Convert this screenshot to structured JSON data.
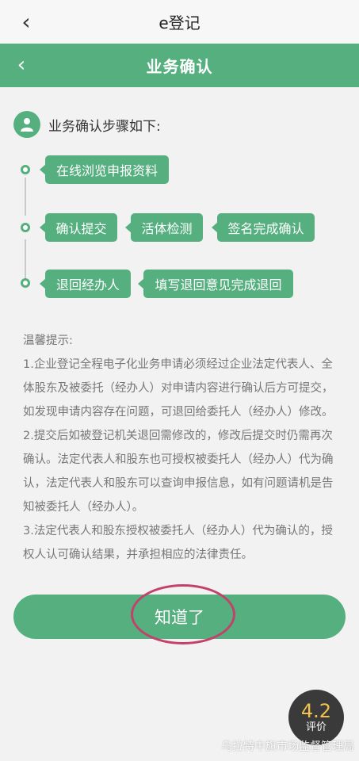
{
  "app": {
    "title": "e登记"
  },
  "header": {
    "title": "业务确认"
  },
  "steps": {
    "heading": "业务确认步骤如下:",
    "row1": [
      "在线浏览申报资料"
    ],
    "row2": [
      "确认提交",
      "活体检测",
      "签名完成确认"
    ],
    "row3": [
      "退回经办人",
      "填写退回意见完成退回"
    ]
  },
  "tips": {
    "title": "温馨提示:",
    "lines": [
      "1.企业登记全程电子化业务申请必须经过企业法定代表人、全体股东及被委托（经办人）对申请内容进行确认后方可提交，如发现申请内容存在问题，可退回给委托人（经办人）修改。",
      "2.提交后如被登记机关退回需修改的，修改后提交时仍需再次确认。法定代表人和股东也可授权被委托人（经办人）代为确认，法定代表人和股东可以查询申报信息，如有问题请机是告知被委托人（经办人）。",
      "3.法定代表人和股东授权被委托人（经办人）代为确认的，授权人认可确认结果，并承担相应的法律责任。"
    ]
  },
  "button": {
    "label": "知道了"
  },
  "rating": {
    "score": "4.2",
    "label": "评价"
  },
  "watermark": "乌拉特中旗市场监督管理局",
  "colors": {
    "accent": "#55af7f",
    "annotation_ring": "#c2426b"
  }
}
